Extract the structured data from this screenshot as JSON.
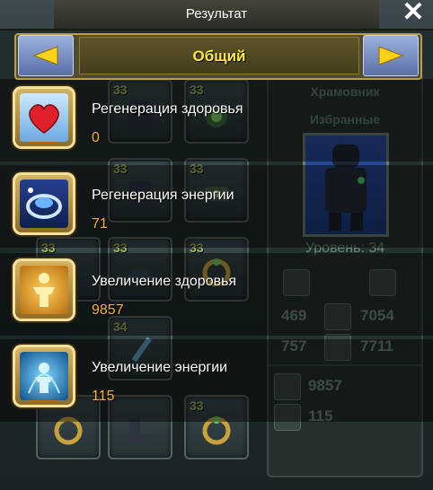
{
  "header": {
    "title": "Результат"
  },
  "tabs": {
    "current": "Общий"
  },
  "entries": [
    {
      "name": "Регенерация здоровья",
      "value": "0",
      "icon": "heart-icon"
    },
    {
      "name": "Регенерация энергии",
      "value": "71",
      "icon": "energy-swirl-icon"
    },
    {
      "name": "Увеличение здоровья",
      "value": "9857",
      "icon": "body-health-icon"
    },
    {
      "name": "Увеличение энергии",
      "value": "115",
      "icon": "body-energy-icon"
    }
  ],
  "inventory": {
    "item_levels": [
      "33",
      "33",
      "33",
      "33",
      "33",
      "33",
      "34",
      "33",
      "33"
    ]
  },
  "character": {
    "name": "Храмовник",
    "group": "Избранные",
    "level": "Уровень: 34",
    "stats": {
      "attack": "469",
      "agility": "7054",
      "defense": "757",
      "energy_res": "7711"
    },
    "health": "9857",
    "energy": "115"
  },
  "colors": {
    "value": "#ffb229",
    "tab_label": "#ffe840",
    "title": "#ffffff"
  }
}
